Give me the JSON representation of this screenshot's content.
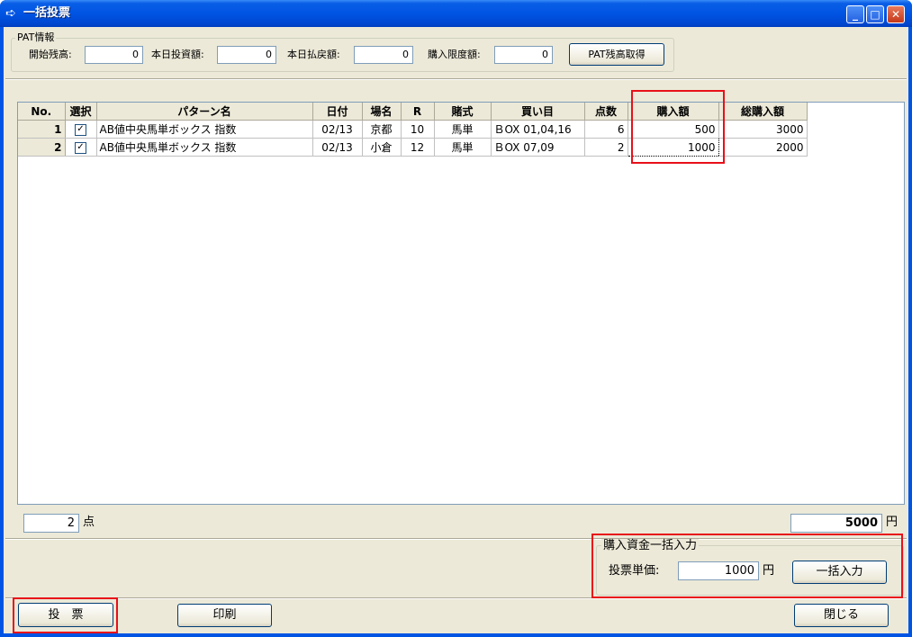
{
  "window": {
    "title": "一括投票",
    "icon": "arrow-icon"
  },
  "pat_info": {
    "group_title": "PAT情報",
    "start_balance_label": "開始残高:",
    "start_balance": "0",
    "today_bet_label": "本日投資額:",
    "today_bet": "0",
    "today_payout_label": "本日払戻額:",
    "today_payout": "0",
    "purchase_limit_label": "購入限度額:",
    "purchase_limit": "0",
    "get_balance_button": "PAT残高取得"
  },
  "table": {
    "columns": [
      "No.",
      "選択",
      "パターン名",
      "日付",
      "場名",
      "R",
      "賭式",
      "買い目",
      "点数",
      "購入額",
      "総購入額"
    ],
    "rows": [
      {
        "no": "1",
        "selected": "✓",
        "pattern": "AB値中央馬単ボックス 指数",
        "date": "02/13",
        "venue": "京都",
        "race": "10",
        "bet_type": "馬単",
        "selection": "ＢOX 01,04,16",
        "points": "6",
        "amount": "500",
        "total": "3000"
      },
      {
        "no": "2",
        "selected": "✓",
        "pattern": "AB値中央馬単ボックス 指数",
        "date": "02/13",
        "venue": "小倉",
        "race": "12",
        "bet_type": "馬単",
        "selection": "ＢOX 07,09",
        "points": "2",
        "amount": "1000",
        "total": "2000"
      }
    ]
  },
  "summary": {
    "count": "2",
    "count_unit": "点",
    "total": "5000",
    "total_unit": "円"
  },
  "bulk": {
    "group_title": "購入資金一括入力",
    "unit_price_label": "投票単価:",
    "unit_price": "1000",
    "unit": "円",
    "apply_button": "一括入力"
  },
  "footer": {
    "vote_button": "投　票",
    "print_button": "印刷",
    "close_button": "閉じる"
  },
  "colors": {
    "title_bar": "#0054e3",
    "highlight": "#e8101a",
    "face": "#ece9d8"
  }
}
